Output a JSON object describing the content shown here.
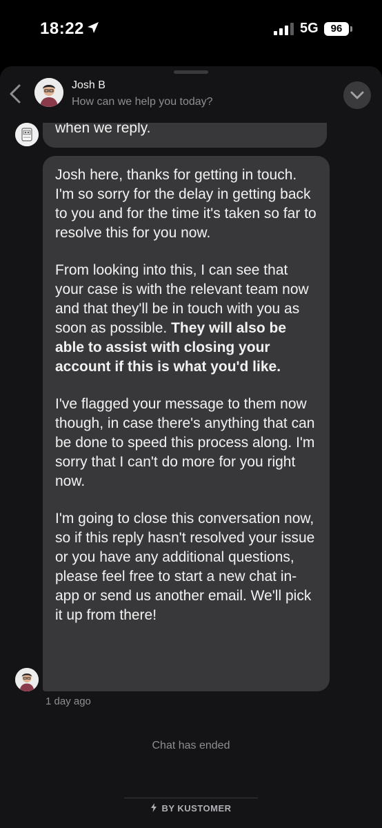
{
  "status_bar": {
    "time": "18:22",
    "network": "5G",
    "battery": "96"
  },
  "header": {
    "agent_name": "Josh B",
    "subtitle": "How can we help you today?"
  },
  "messages": {
    "partial_text": "when we reply.",
    "p1": "Josh here, thanks for getting in touch. I'm so sorry for the delay in getting back to you and for the time it's taken so far to resolve this for you now.",
    "p2_normal": "From looking into this, I can see that your case is with the relevant team now and that they'll be in touch with you as soon as possible. ",
    "p2_bold": "They will also be able to assist with closing your account if this is what you'd like.",
    "p3": "I've flagged your message to them now though, in case there's anything that can be done to speed this process along. I'm sorry that I can't do more for you right now.",
    "p4": "I'm going to close this conversation now, so if this reply hasn't resolved your issue or you have any additional questions, please feel free to start a new chat in-app or send us another email. We'll pick it up from there!",
    "timestamp": "1 day ago"
  },
  "chat_status": "Chat has ended",
  "footer": {
    "powered_by": "BY KUSTOMER"
  },
  "colors": {
    "background": "#141416",
    "bubble": "#38383a",
    "muted_text": "#8e8e93"
  },
  "icons": [
    "location-arrow-icon",
    "signal-icon",
    "battery-icon",
    "back-chevron-icon",
    "collapse-chevron-icon",
    "bolt-icon"
  ]
}
